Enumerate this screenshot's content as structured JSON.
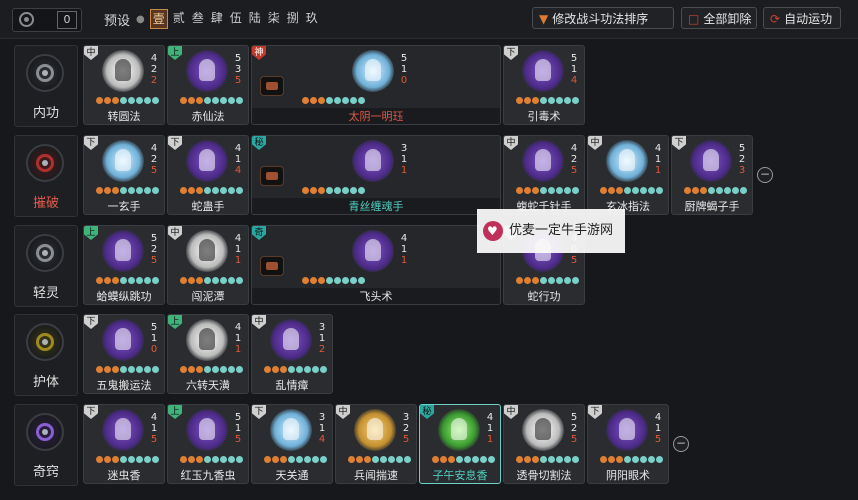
{
  "topbar": {
    "currency_value": "0",
    "preset_label": "预设",
    "preset_dot": "●",
    "presets": [
      "壹",
      "贰",
      "叁",
      "肆",
      "伍",
      "陆",
      "柒",
      "捌",
      "玖"
    ],
    "active_preset": 0,
    "sort_button": "修改战斗功法排序",
    "clear_button": "全部卸除",
    "auto_button": "自动运功"
  },
  "categories": [
    {
      "name": "内功",
      "color": "gray"
    },
    {
      "name": "摧破",
      "color": "red"
    },
    {
      "name": "轻灵",
      "color": "gray"
    },
    {
      "name": "护体",
      "color": "green"
    },
    {
      "name": "奇窍",
      "color": "purple"
    }
  ],
  "rows": [
    [
      {
        "name": "转圆法",
        "rank": "中",
        "a": "4",
        "b": "2",
        "c": "2",
        "art": "white"
      },
      {
        "name": "赤仙法",
        "rank": "上",
        "a": "5",
        "b": "3",
        "c": "5",
        "art": "purple"
      },
      {
        "name": "太阴一明珏",
        "rank": "神",
        "a": "5",
        "b": "1",
        "c": "0",
        "art": "blue",
        "wide": true,
        "labelColor": "red"
      },
      {
        "name": "引毒术",
        "rank": "下",
        "a": "5",
        "b": "1",
        "c": "4",
        "art": "purple"
      }
    ],
    [
      {
        "name": "一玄手",
        "rank": "下",
        "a": "4",
        "b": "2",
        "c": "5",
        "art": "blue"
      },
      {
        "name": "蛇蛊手",
        "rank": "下",
        "a": "4",
        "b": "1",
        "c": "4",
        "art": "purple"
      },
      {
        "name": "青丝缠魂手",
        "rank": "秘",
        "a": "3",
        "b": "1",
        "c": "1",
        "art": "purple",
        "wide": true,
        "labelColor": "teal"
      },
      {
        "name": "蝮蛇千针手",
        "rank": "中",
        "a": "4",
        "b": "2",
        "c": "5",
        "art": "purple"
      },
      {
        "name": "玄冰指法",
        "rank": "中",
        "a": "4",
        "b": "1",
        "c": "1",
        "art": "blue"
      },
      {
        "name": "厨牌蝎子手",
        "rank": "下",
        "a": "5",
        "b": "2",
        "c": "3",
        "art": "purple"
      }
    ],
    [
      {
        "name": "蛤蟆纵跳功",
        "rank": "上",
        "a": "5",
        "b": "2",
        "c": "5",
        "art": "purple"
      },
      {
        "name": "闯泥潭",
        "rank": "中",
        "a": "4",
        "b": "1",
        "c": "1",
        "art": "white"
      },
      {
        "name": "飞头术",
        "rank": "奇",
        "a": "4",
        "b": "1",
        "c": "1",
        "art": "purple",
        "wide": true
      },
      {
        "name": "蛇行功",
        "rank": "下",
        "a": "4",
        "b": "0",
        "c": "5",
        "art": "purple"
      }
    ],
    [
      {
        "name": "五鬼搬运法",
        "rank": "下",
        "a": "5",
        "b": "1",
        "c": "0",
        "art": "purple"
      },
      {
        "name": "六转天潢",
        "rank": "上",
        "a": "4",
        "b": "1",
        "c": "1",
        "art": "white"
      },
      {
        "name": "乱情瘴",
        "rank": "中",
        "a": "3",
        "b": "1",
        "c": "2",
        "art": "purple"
      }
    ],
    [
      {
        "name": "迷虫香",
        "rank": "下",
        "a": "4",
        "b": "1",
        "c": "5",
        "art": "purple"
      },
      {
        "name": "红玉九香虫",
        "rank": "上",
        "a": "5",
        "b": "1",
        "c": "5",
        "art": "purple"
      },
      {
        "name": "天关通",
        "rank": "下",
        "a": "3",
        "b": "1",
        "c": "4",
        "art": "blue"
      },
      {
        "name": "兵闻揣速",
        "rank": "中",
        "a": "3",
        "b": "2",
        "c": "5",
        "art": "gold"
      },
      {
        "name": "子午安息香",
        "rank": "秘",
        "a": "4",
        "b": "1",
        "c": "1",
        "art": "green",
        "selected": true,
        "labelColor": "teal"
      },
      {
        "name": "透骨切割法",
        "rank": "中",
        "a": "5",
        "b": "2",
        "c": "5",
        "art": "white"
      },
      {
        "name": "阴阳眼术",
        "rank": "下",
        "a": "4",
        "b": "1",
        "c": "5",
        "art": "purple"
      }
    ]
  ],
  "watermark": "优麦一定牛手游网"
}
